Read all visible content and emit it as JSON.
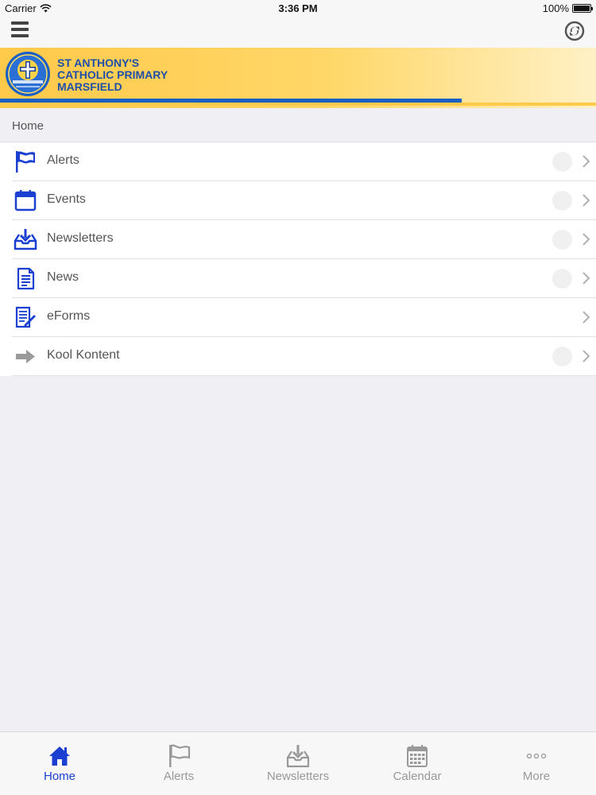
{
  "status_bar": {
    "carrier": "Carrier",
    "time": "3:36 PM",
    "battery": "100%"
  },
  "banner": {
    "line1": "ST ANTHONY'S",
    "line2": "CATHOLIC PRIMARY",
    "line3": "MARSFIELD"
  },
  "breadcrumb": "Home",
  "menu": [
    {
      "label": "Alerts",
      "icon": "flag-icon"
    },
    {
      "label": "Events",
      "icon": "calendar-icon"
    },
    {
      "label": "Newsletters",
      "icon": "inbox-download-icon"
    },
    {
      "label": "News",
      "icon": "document-icon"
    },
    {
      "label": "eForms",
      "icon": "form-pen-icon"
    },
    {
      "label": "Kool Kontent",
      "icon": "arrow-right-icon"
    }
  ],
  "tabs": [
    {
      "label": "Home",
      "icon": "home-icon",
      "active": true
    },
    {
      "label": "Alerts",
      "icon": "flag-icon"
    },
    {
      "label": "Newsletters",
      "icon": "inbox-download-icon"
    },
    {
      "label": "Calendar",
      "icon": "calendar-grid-icon"
    },
    {
      "label": "More",
      "icon": "more-dots-icon"
    }
  ],
  "colors": {
    "accent": "#1a3fd1",
    "banner_yellow": "#ffc94a",
    "banner_blue": "#1a5fc4"
  }
}
